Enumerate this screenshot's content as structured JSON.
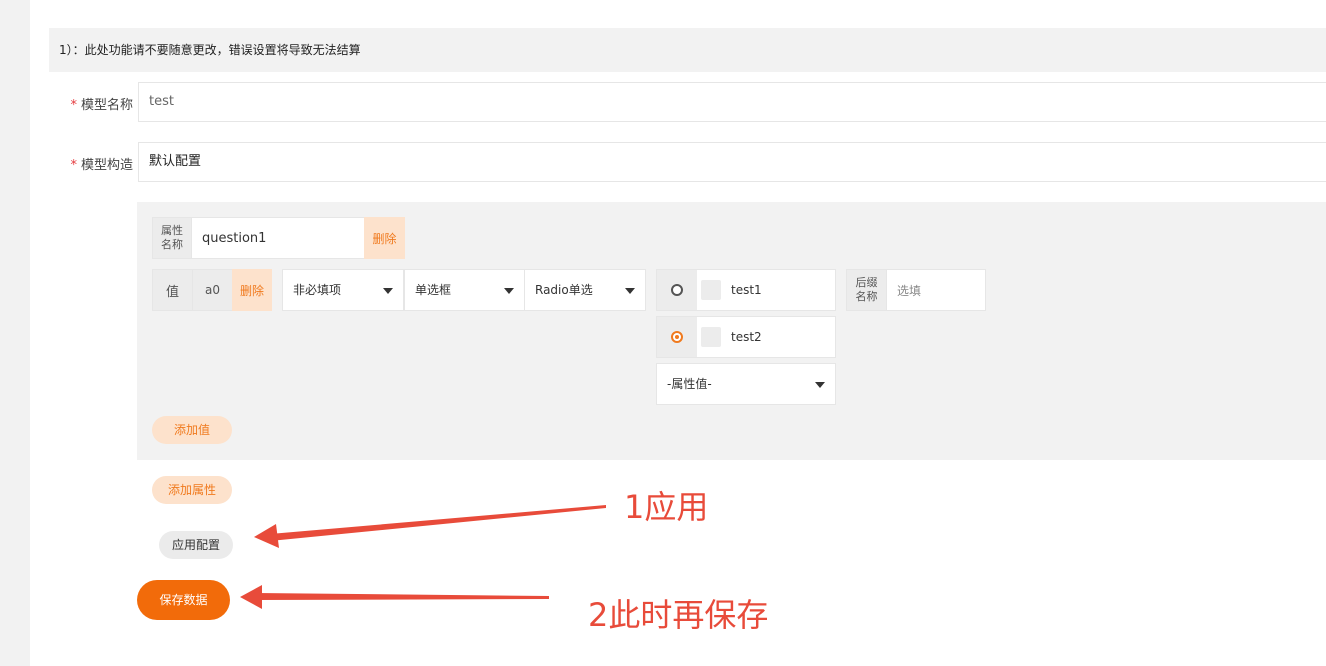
{
  "notice": "1）：此处功能请不要随意更改，错误设置将导致无法结算",
  "form": {
    "required_mark": "*",
    "model_name_label": "模型名称",
    "model_name_value": "test",
    "model_struct_label": "模型构造",
    "model_struct_value": "默认配置"
  },
  "attribute": {
    "name_label_line1": "属性",
    "name_label_line2": "名称",
    "name_value": "question1",
    "delete_label": "删除"
  },
  "value_row": {
    "value_label": "值",
    "value_code": "a0",
    "delete_label": "删除",
    "required_select": "非必填项",
    "widget_select": "单选框",
    "type_select": "Radio单选",
    "options": [
      {
        "text": "test1",
        "selected": false
      },
      {
        "text": "test2",
        "selected": true
      }
    ],
    "attr_value_select": "-属性值-",
    "suffix_label_line1": "后缀",
    "suffix_label_line2": "名称",
    "suffix_placeholder": "选填"
  },
  "buttons": {
    "add_value": "添加值",
    "add_attribute": "添加属性",
    "apply_config": "应用配置",
    "save_data": "保存数据"
  },
  "annotations": {
    "step1": "1应用",
    "step2": "2此时再保存"
  },
  "colors": {
    "accent": "#f26b0a",
    "accent_light": "#fde2cc",
    "annotation_red": "#e84b3a"
  }
}
